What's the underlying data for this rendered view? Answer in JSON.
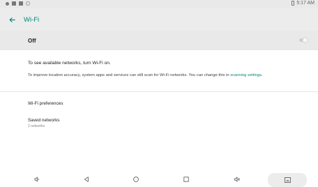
{
  "status_bar": {
    "time": "5:17 AM",
    "icons": [
      "notification-dot-icon",
      "notification-square-icon",
      "photo-notification-icon",
      "sync-circle-icon",
      "battery-icon"
    ]
  },
  "header": {
    "title": "Wi-Fi",
    "back_icon": "arrow-back-icon",
    "accent_color": "#00897b"
  },
  "wifi_toggle": {
    "label": "Off",
    "state": "off"
  },
  "info": {
    "message": "To see available networks, turn Wi-Fi on.",
    "location_prefix": "To improve location accuracy, system apps and services can still scan for Wi-Fi networks. You can change this in ",
    "location_link": "scanning settings",
    "location_suffix": "."
  },
  "settings_list": {
    "preferences_label": "Wi-Fi preferences",
    "saved_networks_label": "Saved networks",
    "saved_networks_count": "2 networks"
  },
  "nav_bar": {
    "buttons": [
      "volume-down-icon",
      "back-triangle-icon",
      "home-circle-icon",
      "recents-square-icon",
      "volume-up-icon",
      "screenshot-icon"
    ]
  }
}
